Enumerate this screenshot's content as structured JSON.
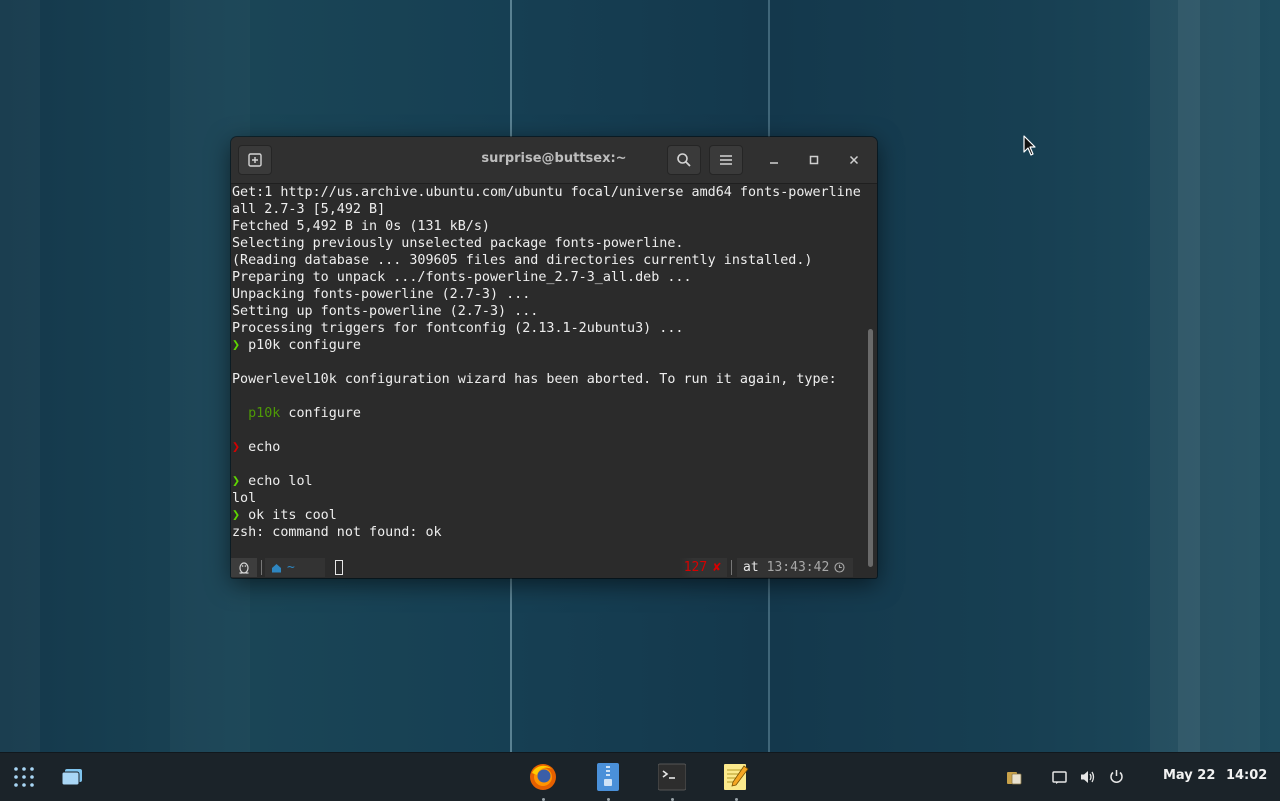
{
  "terminal": {
    "title": "surprise@buttsex:~",
    "lines": [
      [
        {
          "t": "Get:1 http://us.archive.ubuntu.com/ubuntu focal/universe amd64 fonts-powerline",
          "c": "#eeeeee"
        }
      ],
      [
        {
          "t": "all 2.7-3 [5,492 B]",
          "c": "#eeeeee"
        }
      ],
      [
        {
          "t": "Fetched 5,492 B in 0s (131 kB/s)",
          "c": "#eeeeee"
        }
      ],
      [
        {
          "t": "Selecting previously unselected package fonts-powerline.",
          "c": "#eeeeee"
        }
      ],
      [
        {
          "t": "(Reading database ... 309605 files and directories currently installed.)",
          "c": "#eeeeee"
        }
      ],
      [
        {
          "t": "Preparing to unpack .../fonts-powerline_2.7-3_all.deb ...",
          "c": "#eeeeee"
        }
      ],
      [
        {
          "t": "Unpacking fonts-powerline (2.7-3) ...",
          "c": "#eeeeee"
        }
      ],
      [
        {
          "t": "Setting up fonts-powerline (2.7-3) ...",
          "c": "#eeeeee"
        }
      ],
      [
        {
          "t": "Processing triggers for fontconfig (2.13.1-2ubuntu3) ...",
          "c": "#eeeeee"
        }
      ],
      [
        {
          "t": "❯ ",
          "c": "#5fd700"
        },
        {
          "t": "p10k configure",
          "c": "#eeeeee"
        }
      ],
      [],
      [
        {
          "t": "Powerlevel10k configuration wizard has been aborted. To run it again, type:",
          "c": "#eeeeee"
        }
      ],
      [],
      [
        {
          "t": "  p10k",
          "c": "#4e9a06"
        },
        {
          "t": " configure",
          "c": "#eeeeee"
        }
      ],
      [],
      [
        {
          "t": "❯ ",
          "c": "#d70000"
        },
        {
          "t": "echo",
          "c": "#eeeeee"
        }
      ],
      [],
      [
        {
          "t": "❯ ",
          "c": "#5fd700"
        },
        {
          "t": "echo lol",
          "c": "#eeeeee"
        }
      ],
      [
        {
          "t": "lol",
          "c": "#eeeeee"
        }
      ],
      [
        {
          "t": "❯ ",
          "c": "#5fd700"
        },
        {
          "t": "ok its cool",
          "c": "#eeeeee"
        }
      ],
      [
        {
          "t": "zsh: command not found: ok",
          "c": "#eeeeee"
        }
      ]
    ],
    "status": {
      "os_icon": "linux-icon",
      "home_icon": "home-icon",
      "dir": "~",
      "exit_code": "127",
      "error_mark": "✘",
      "at_label": "at",
      "time": "13:43:42",
      "clock_icon": "clock-icon"
    }
  },
  "taskbar": {
    "date": "May 22",
    "time": "14:02",
    "apps": [
      "firefox-icon",
      "files-icon",
      "terminal-icon",
      "text-editor-icon"
    ]
  },
  "colors": {
    "prompt_ok": "#5fd700",
    "prompt_err": "#d70000",
    "dir_fg": "#2e86c1",
    "status_err": "#d70000"
  }
}
